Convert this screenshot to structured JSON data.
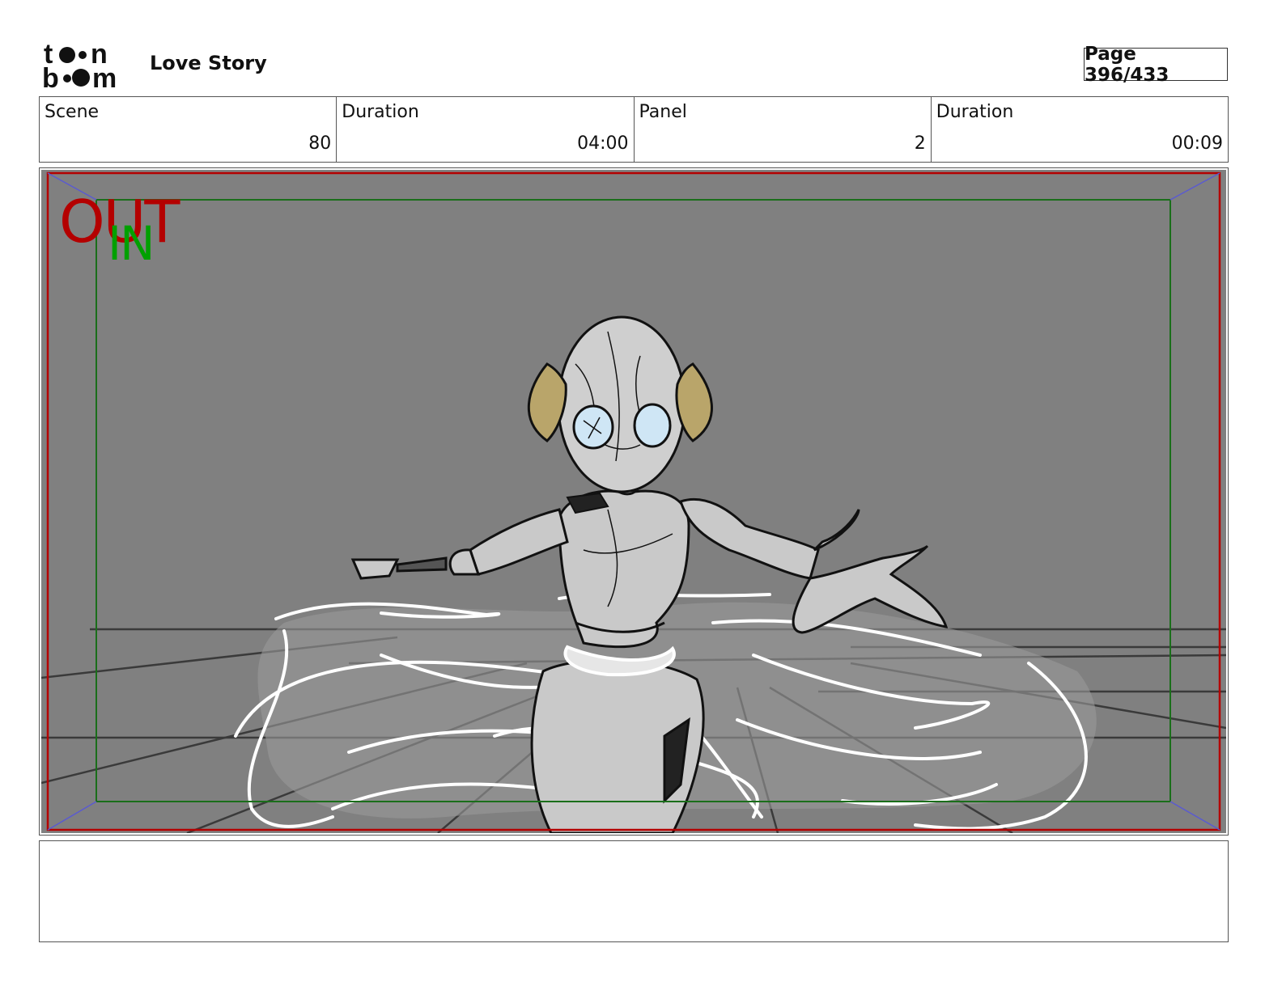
{
  "header": {
    "logo_text": "toon boom",
    "project_title": "Love Story",
    "page_label": "Page 396/433"
  },
  "info": {
    "scene_label": "Scene",
    "scene_value": "80",
    "scene_duration_label": "Duration",
    "scene_duration_value": "04:00",
    "panel_label": "Panel",
    "panel_value": "2",
    "panel_duration_label": "Duration",
    "panel_duration_value": "00:09"
  },
  "panel": {
    "camera_out_label": "OUT",
    "camera_in_label": "IN",
    "colors": {
      "background": "#808080",
      "out_frame": "#b40000",
      "in_frame": "#1a6e1a",
      "ear_accent": "#b9a56a",
      "eye_fill": "#cfe6f5"
    }
  },
  "notes": {
    "text": ""
  }
}
